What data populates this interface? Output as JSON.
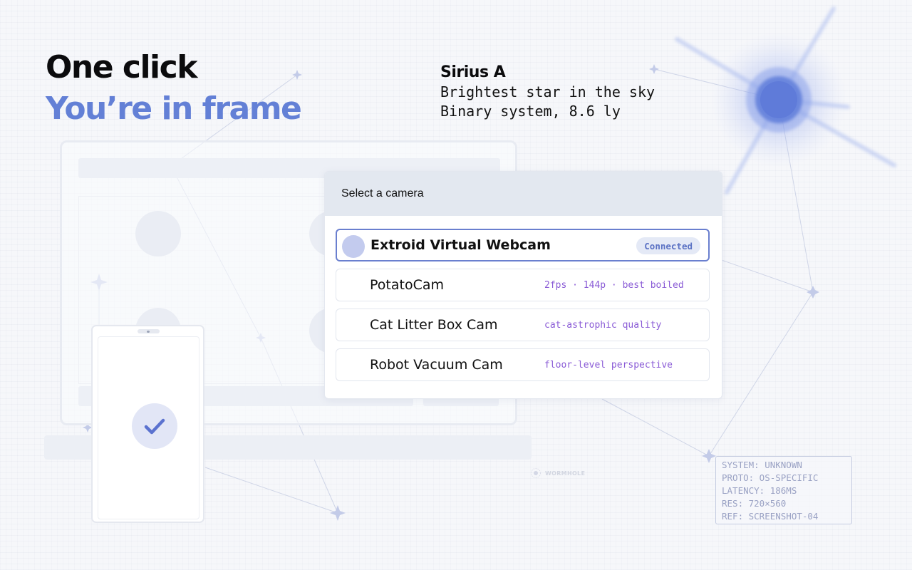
{
  "headline": {
    "line1": "One click",
    "line2": "You’re in frame"
  },
  "star": {
    "name": "Sirius A",
    "line1": "Brightest star in the sky",
    "line2": "Binary system, 8.6 ly"
  },
  "camera_panel": {
    "title": "Select a camera",
    "cameras": [
      {
        "name": "Extroid Virtual Webcam",
        "badge": "Connected",
        "selected": true
      },
      {
        "name": "PotatoCam",
        "note": "2fps · 144p · best boiled"
      },
      {
        "name": "Cat Litter Box Cam",
        "note": "cat-astrophic quality"
      },
      {
        "name": "Robot Vacuum Cam",
        "note": "floor-level perspective"
      }
    ]
  },
  "phone": {
    "icon": "checkmark-icon"
  },
  "logo": {
    "text": "WORMHOLE",
    "icon": "wormhole-logo-icon"
  },
  "system_info": {
    "lines": [
      "SYSTEM: UNKNOWN",
      "PROTO: OS-SPECIFIC",
      "LATENCY: 186MS",
      "RES: 720×560",
      "REF: SCREENSHOT-04"
    ]
  },
  "colors": {
    "accent": "#6380d6",
    "note_text": "#8a5bd6",
    "selected_border": "#6a7fcf",
    "star_core": "#6b86dd"
  }
}
